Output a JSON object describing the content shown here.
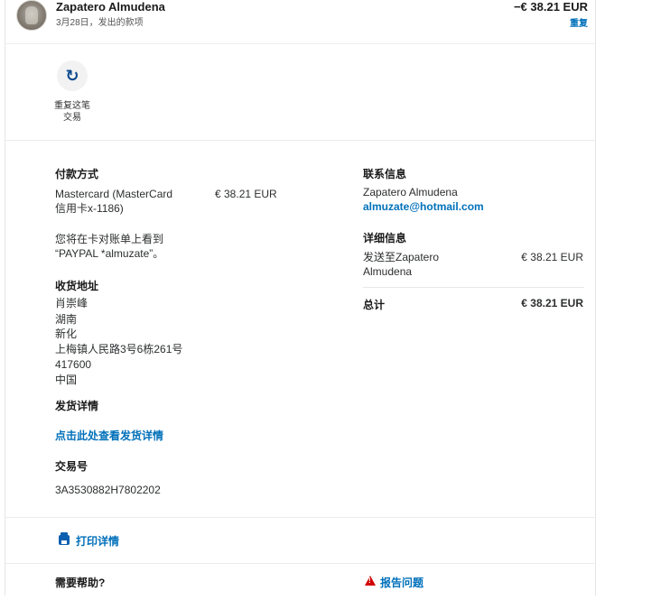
{
  "header": {
    "name": "Zapatero Almudena",
    "subtitle": "3月28日，发出的款项",
    "amount": "−€ 38.21 EUR",
    "repeat_link": "重复"
  },
  "actions": {
    "repeat_icon": "refresh-icon",
    "repeat_label": "重复这笔交易"
  },
  "payment": {
    "title": "付款方式",
    "method": "Mastercard (MasterCard信用卡x-1186)",
    "statement_note": "您将在卡对账单上看到 “PAYPAL *almuzate”。",
    "amount": "€ 38.21 EUR"
  },
  "shipping": {
    "title": "收货地址",
    "lines": [
      "肖崇峰",
      "湖南",
      "新化",
      "上梅镇人民路3号6栋261号",
      "417600",
      "中国"
    ]
  },
  "shipping_details": {
    "title": "发货详情",
    "link": "点击此处查看发货详情"
  },
  "transaction": {
    "title": "交易号",
    "id": "3A3530882H7802202"
  },
  "contact": {
    "title": "联系信息",
    "name": "Zapatero Almudena",
    "email": "almuzate@hotmail.com"
  },
  "details": {
    "title": "详细信息",
    "item_label": "发送至Zapatero Almudena",
    "item_amount": "€ 38.21 EUR",
    "total_label": "总计",
    "total_amount": "€ 38.21 EUR"
  },
  "footer": {
    "print_icon": "printer-icon",
    "print_label": "打印详情",
    "help_title": "需要帮助?",
    "report_icon": "warning-icon",
    "report_label": "报告问题"
  },
  "colors": {
    "link": "#0070ba",
    "warning": "#d20000",
    "text": "#2c2e2f"
  }
}
